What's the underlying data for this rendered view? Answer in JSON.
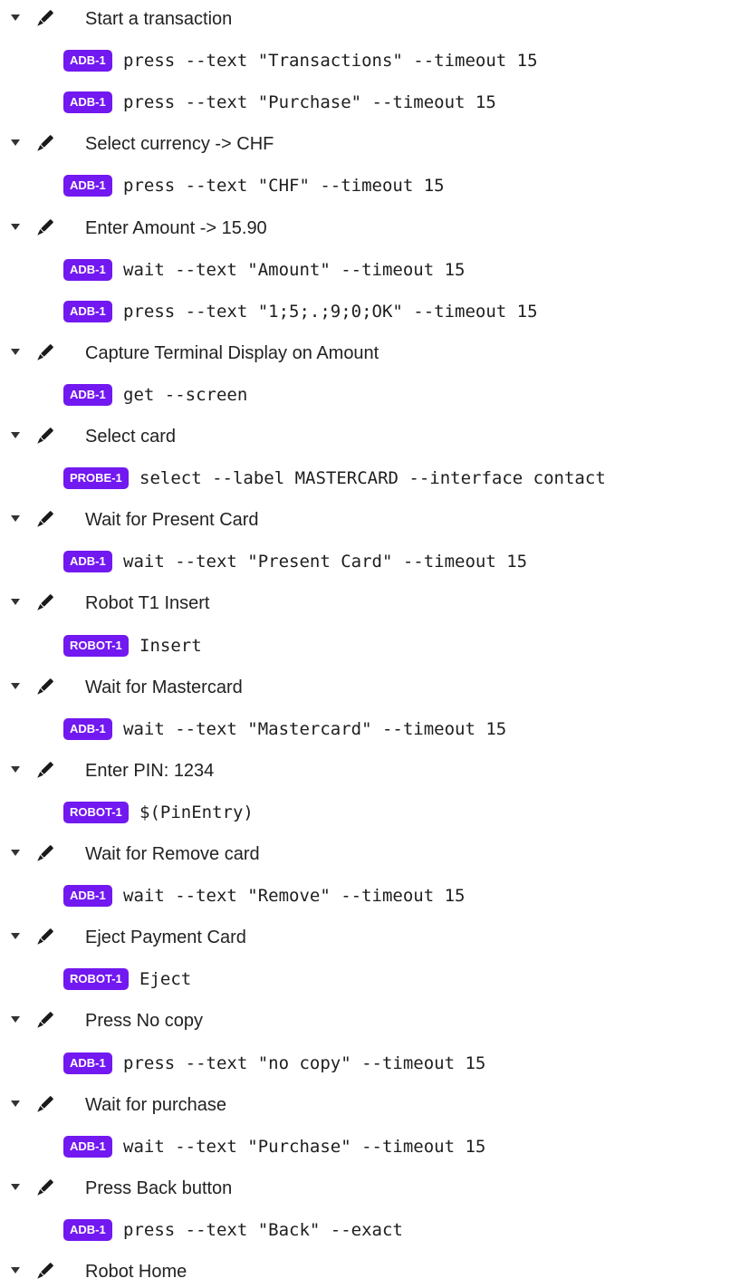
{
  "steps": [
    {
      "title": "Start a transaction",
      "commands": [
        {
          "badge": "ADB-1",
          "text": "press --text \"Transactions\" --timeout 15"
        },
        {
          "badge": "ADB-1",
          "text": "press --text \"Purchase\" --timeout 15"
        }
      ]
    },
    {
      "title": "Select currency -> CHF",
      "commands": [
        {
          "badge": "ADB-1",
          "text": "press --text \"CHF\" --timeout 15"
        }
      ]
    },
    {
      "title": "Enter Amount -> 15.90",
      "commands": [
        {
          "badge": "ADB-1",
          "text": "wait --text \"Amount\" --timeout 15"
        },
        {
          "badge": "ADB-1",
          "text": "press --text \"1;5;.;9;0;OK\" --timeout 15"
        }
      ]
    },
    {
      "title": "Capture Terminal Display on Amount",
      "commands": [
        {
          "badge": "ADB-1",
          "text": "get --screen"
        }
      ]
    },
    {
      "title": "Select card",
      "commands": [
        {
          "badge": "PROBE-1",
          "text": "select --label MASTERCARD --interface contact"
        }
      ]
    },
    {
      "title": "Wait for Present Card",
      "commands": [
        {
          "badge": "ADB-1",
          "text": "wait --text \"Present Card\" --timeout 15"
        }
      ]
    },
    {
      "title": "Robot T1 Insert",
      "commands": [
        {
          "badge": "ROBOT-1",
          "text": "Insert"
        }
      ]
    },
    {
      "title": "Wait for Mastercard",
      "commands": [
        {
          "badge": "ADB-1",
          "text": "wait --text \"Mastercard\" --timeout 15"
        }
      ]
    },
    {
      "title": "Enter PIN: 1234",
      "commands": [
        {
          "badge": "ROBOT-1",
          "text": "$(PinEntry)"
        }
      ]
    },
    {
      "title": "Wait for Remove card",
      "commands": [
        {
          "badge": "ADB-1",
          "text": "wait --text \"Remove\" --timeout 15"
        }
      ]
    },
    {
      "title": "Eject Payment Card",
      "commands": [
        {
          "badge": "ROBOT-1",
          "text": "Eject"
        }
      ]
    },
    {
      "title": "Press No copy",
      "commands": [
        {
          "badge": "ADB-1",
          "text": "press --text \"no copy\" --timeout 15"
        }
      ]
    },
    {
      "title": "Wait for purchase",
      "commands": [
        {
          "badge": "ADB-1",
          "text": "wait --text \"Purchase\" --timeout 15"
        }
      ]
    },
    {
      "title": "Press Back button",
      "commands": [
        {
          "badge": "ADB-1",
          "text": "press --text \"Back\" --exact"
        }
      ]
    },
    {
      "title": "Robot Home",
      "commands": []
    }
  ],
  "colors": {
    "badge_bg": "#7218f0",
    "badge_fg": "#ffffff",
    "text": "#222222",
    "caret": "#333333"
  },
  "icons": {
    "expand": "caret-down-icon",
    "step": "pen-icon"
  }
}
